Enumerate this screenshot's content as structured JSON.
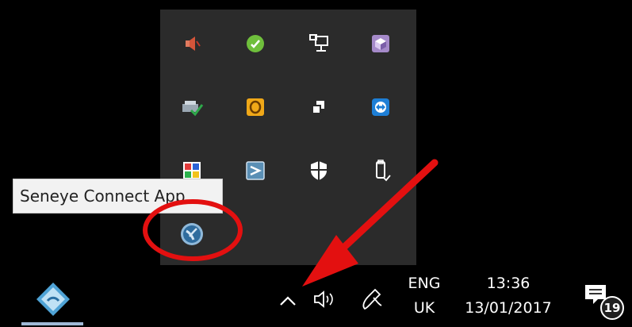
{
  "tooltip": {
    "text": "Seneye Connect App"
  },
  "tray_flyout": {
    "icons": [
      "volume-muted-icon",
      "skype-icon",
      "network-icon",
      "app-cube-icon",
      "printer-check-icon",
      "outlook-icon",
      "copy-windows-icon",
      "teamviewer-icon",
      "colorful-grid-icon",
      "vmware-icon",
      "windows-defender-icon",
      "usb-eject-icon",
      "seneye-connect-icon"
    ]
  },
  "taskbar": {
    "show_hidden_icons": "chevron-up-icon",
    "volume": "speaker-icon",
    "pen": "pen-icon",
    "language": {
      "top": "ENG",
      "bottom": "UK"
    },
    "clock": {
      "time": "13:36",
      "date": "13/01/2017"
    },
    "notifications": {
      "count": "19"
    }
  },
  "annotations": {
    "arrow_color": "#ff0000",
    "circle_color": "#ff0000"
  }
}
